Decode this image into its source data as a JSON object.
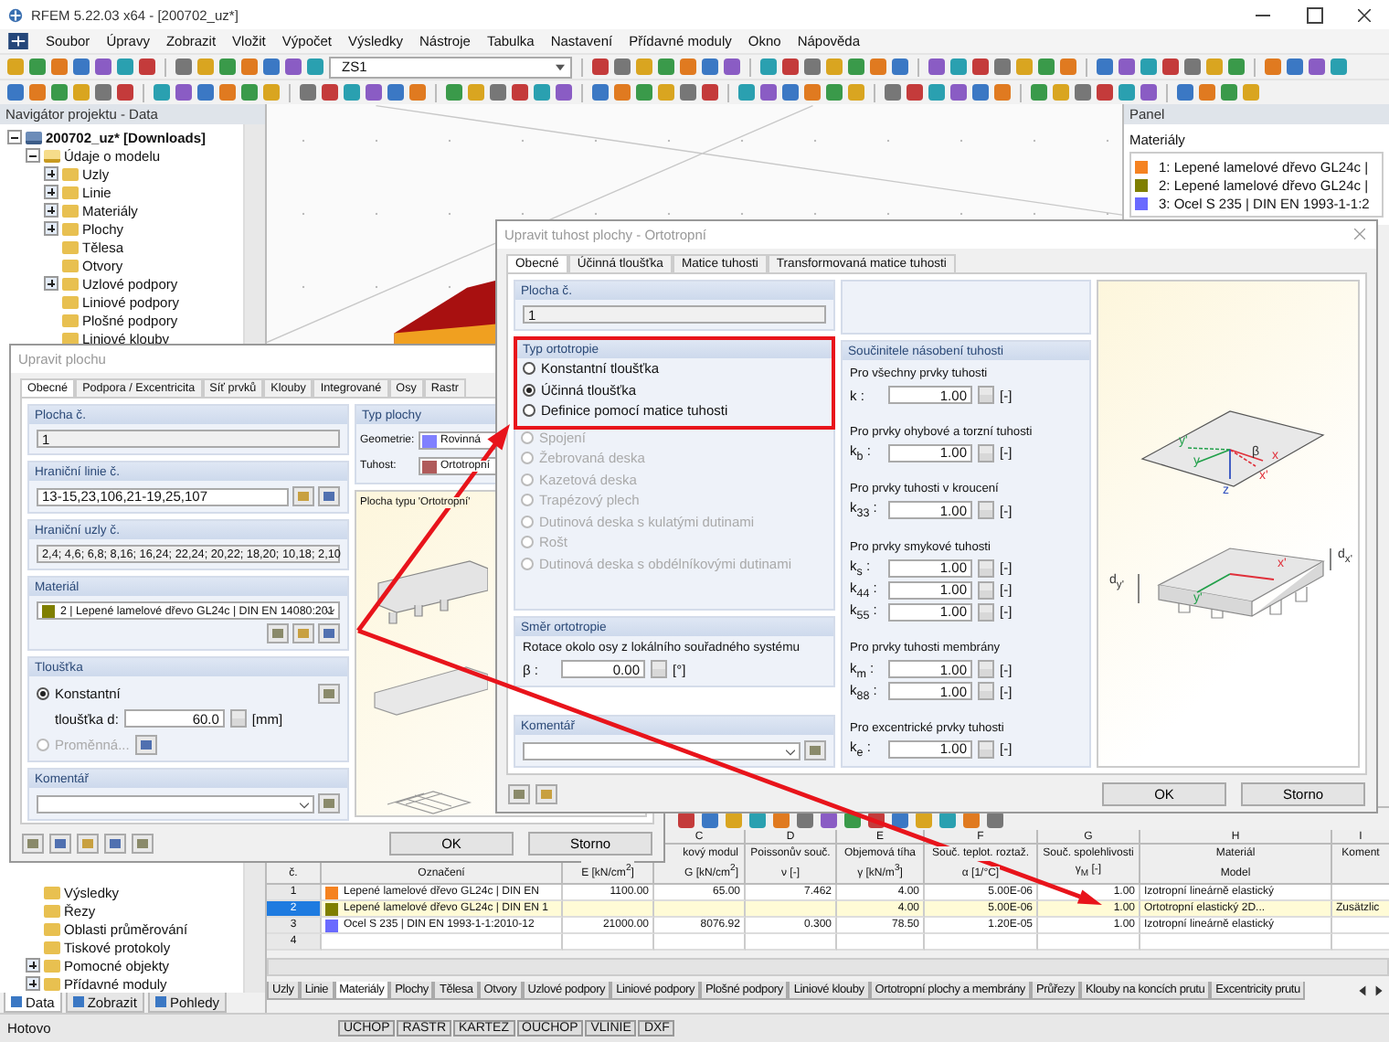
{
  "window": {
    "title": "RFEM 5.22.03 x64 - [200702_uz*]"
  },
  "menu": [
    "Soubor",
    "Úpravy",
    "Zobrazit",
    "Vložit",
    "Výpočet",
    "Výsledky",
    "Nástroje",
    "Tabulka",
    "Nastavení",
    "Přídavné moduly",
    "Okno",
    "Nápověda"
  ],
  "toolbar": {
    "load_case": "ZS1"
  },
  "navigator": {
    "title": "Navigátor projektu - Data",
    "tree": [
      {
        "label": "200702_uz* [Downloads]",
        "expandable": true,
        "expanded": true,
        "children": [
          {
            "label": "Údaje o modelu",
            "expandable": true,
            "expanded": true,
            "children": [
              {
                "label": "Uzly",
                "expandable": true,
                "expanded": false
              },
              {
                "label": "Linie",
                "expandable": true,
                "expanded": false
              },
              {
                "label": "Materiály",
                "expandable": true,
                "expanded": false
              },
              {
                "label": "Plochy",
                "expandable": true,
                "expanded": false
              },
              {
                "label": "Tělesa",
                "expandable": false
              },
              {
                "label": "Otvory",
                "expandable": false
              },
              {
                "label": "Uzlové podpory",
                "expandable": true,
                "expanded": false
              },
              {
                "label": "Liniové podpory",
                "expandable": false
              },
              {
                "label": "Plošné podpory",
                "expandable": false
              },
              {
                "label": "Liniové klouby",
                "expandable": false
              }
            ]
          }
        ]
      }
    ],
    "lower_items": [
      {
        "label": "Výsledky",
        "expandable": false
      },
      {
        "label": "Řezy",
        "expandable": false
      },
      {
        "label": "Oblasti průměrování",
        "expandable": false
      },
      {
        "label": "Tiskové protokoly",
        "expandable": false
      },
      {
        "label": "Pomocné objekty",
        "expandable": true,
        "expanded": false
      },
      {
        "label": "Přídavné moduly",
        "expandable": true,
        "expanded": false
      }
    ],
    "tabs": [
      {
        "label": "Data",
        "selected": true
      },
      {
        "label": "Zobrazit",
        "selected": false
      },
      {
        "label": "Pohledy",
        "selected": false
      }
    ]
  },
  "panel": {
    "title": "Panel",
    "section": "Materiály",
    "items": [
      {
        "label": "1: Lepené lamelové dřevo GL24c |",
        "color": "#f58220"
      },
      {
        "label": "2: Lepené lamelové dřevo GL24c |",
        "color": "#7f7f00"
      },
      {
        "label": "3: Ocel S 235 | DIN EN 1993-1-1:2",
        "color": "#6a6aff"
      }
    ]
  },
  "table": {
    "columns": [
      {
        "bottom": "č."
      },
      {
        "bottom": "Označení"
      },
      {
        "bottom": "E [kN/cm$^{2}$]"
      },
      {
        "letter": "C",
        "top": "kový modul",
        "bottom": "G [kN/cm$^{2}$]"
      },
      {
        "letter": "D",
        "top": "Poissonův souč.",
        "bottom": "ν [-]"
      },
      {
        "letter": "E",
        "top": "Objemová tíha",
        "bottom": "γ [kN/m$^{3}$]"
      },
      {
        "letter": "F",
        "top": "Souč. teplot. roztaž.",
        "bottom": "α [1/°C]"
      },
      {
        "letter": "G",
        "top": "Souč. spolehlivosti",
        "bottom": "γ$_{M}$ [-]"
      },
      {
        "letter": "H",
        "top": "Materiál",
        "bottom": "Model"
      },
      {
        "letter": "I",
        "top": "Koment"
      }
    ],
    "rows": [
      {
        "no": "1",
        "color": "#f58220",
        "selected": false,
        "cells": [
          "Lepené lamelové dřevo GL24c | DIN EN",
          "1100.00",
          "65.00",
          "7.462",
          "4.00",
          "5.00E-06",
          "1.00",
          "Izotropní lineárně elastický",
          null
        ]
      },
      {
        "no": "2",
        "color": "#7f7f00",
        "selected": true,
        "cells": [
          "Lepené lamelové dřevo GL24c | DIN EN 1",
          null,
          null,
          null,
          "4.00",
          "5.00E-06",
          "1.00",
          "Ortotropní elastický 2D...",
          "Zusätzlic"
        ]
      },
      {
        "no": "3",
        "color": "#6a6aff",
        "selected": false,
        "cells": [
          "Ocel S 235 | DIN EN 1993-1-1:2010-12",
          "21000.00",
          "8076.92",
          "0.300",
          "78.50",
          "1.20E-05",
          "1.00",
          "Izotropní lineárně elastický",
          null
        ]
      },
      {
        "no": "4",
        "selected": false
      }
    ]
  },
  "table_tabs": [
    {
      "label": "Uzly",
      "selected": false
    },
    {
      "label": "Linie",
      "selected": false
    },
    {
      "label": "Materiály",
      "selected": true
    },
    {
      "label": "Plochy",
      "selected": false
    },
    {
      "label": "Tělesa",
      "selected": false
    },
    {
      "label": "Otvory",
      "selected": false
    },
    {
      "label": "Uzlové podpory",
      "selected": false
    },
    {
      "label": "Liniové podpory",
      "selected": false
    },
    {
      "label": "Plošné podpory",
      "selected": false
    },
    {
      "label": "Liniové klouby",
      "selected": false
    },
    {
      "label": "Ortotropní plochy a membrány",
      "selected": false
    },
    {
      "label": "Průřezy",
      "selected": false
    },
    {
      "label": "Klouby na koncích prutu",
      "selected": false
    },
    {
      "label": "Excentricity prutu",
      "selected": false
    }
  ],
  "status_bar": {
    "text": "Hotovo",
    "toggles": [
      "UCHOP",
      "RASTR",
      "KARTEZ",
      "OUCHOP",
      "VLINIE",
      "DXF"
    ]
  },
  "surface_dialog": {
    "title": "Upravit plochu",
    "tabs": [
      {
        "label": "Obecné",
        "selected": true
      },
      {
        "label": "Podpora / Excentricita",
        "selected": false
      },
      {
        "label": "Síť prvků",
        "selected": false
      },
      {
        "label": "Klouby",
        "selected": false
      },
      {
        "label": "Integrované",
        "selected": false
      },
      {
        "label": "Osy",
        "selected": false
      },
      {
        "label": "Rastr",
        "selected": false
      }
    ],
    "surface_no": {
      "label": "Plocha č.",
      "value": "1"
    },
    "boundary_lines": {
      "label": "Hraniční linie č.",
      "value": "13-15,23,106,21-19,25,107"
    },
    "boundary_nodes": {
      "label": "Hraniční uzly č.",
      "value": "2,4; 4,6; 6,8; 8,16; 16,24; 22,24; 20,22; 18,20; 10,18; 2,10"
    },
    "material": {
      "label": "Materiál",
      "color": "#7f7f00",
      "value": "2 | Lepené lamelové dřevo GL24c | DIN EN 14080:201"
    },
    "thickness": {
      "label": "Tloušťka",
      "options": [
        {
          "label": "Konstantní",
          "selected": true,
          "disabled": false
        },
        {
          "label": "Proměnná...",
          "selected": false,
          "disabled": true
        }
      ],
      "field_label": "tloušťka d:",
      "value": "60.0",
      "unit": "[mm]"
    },
    "comment": {
      "label": "Komentář"
    },
    "surface_type": {
      "label": "Typ plochy",
      "rows": [
        {
          "label": "Geometrie:",
          "value": "Rovinná",
          "color": "#8080ff"
        },
        {
          "label": "Tuhost:",
          "value": "Ortotropní",
          "color": "#b05a5a"
        }
      ]
    },
    "preview_caption": "Plocha typu 'Ortotropní'",
    "buttons": [
      "OK",
      "Storno"
    ]
  },
  "stiffness_dialog": {
    "title": "Upravit tuhost plochy - Ortotropní",
    "tabs": [
      {
        "label": "Obecné",
        "selected": true
      },
      {
        "label": "Účinná tloušťka",
        "selected": false
      },
      {
        "label": "Matice tuhosti",
        "selected": false
      },
      {
        "label": "Transformovaná matice tuhosti",
        "selected": false
      }
    ],
    "surface_no": {
      "label": "Plocha č.",
      "value": "1"
    },
    "orthotropy_type": {
      "label": "Typ ortotropie",
      "highlighted": true,
      "options": [
        {
          "label": "Konstantní tloušťka",
          "selected": false,
          "disabled": false
        },
        {
          "label": "Účinná tloušťka",
          "selected": true,
          "disabled": false
        },
        {
          "label": "Definice pomocí matice tuhosti",
          "selected": false,
          "disabled": false
        }
      ],
      "more_options": [
        {
          "label": "Spojení",
          "selected": false,
          "disabled": true
        },
        {
          "label": "Žebrovaná deska",
          "selected": false,
          "disabled": true
        },
        {
          "label": "Kazetová deska",
          "selected": false,
          "disabled": true
        },
        {
          "label": "Trapézový plech",
          "selected": false,
          "disabled": true
        },
        {
          "label": "Dutinová deska s kulatými dutinami",
          "selected": false,
          "disabled": true
        },
        {
          "label": "Rošt",
          "selected": false,
          "disabled": true
        },
        {
          "label": "Dutinová deska s obdélníkovými dutinami",
          "selected": false,
          "disabled": true
        }
      ]
    },
    "direction": {
      "label": "Směr ortotropie",
      "text": "Rotace okolo osy z lokálního souřadného systému",
      "field_label": "β :",
      "value": "0.00",
      "unit": "[°]"
    },
    "comment": {
      "label": "Komentář"
    },
    "factors": {
      "label": "Součinitele násobení tuhosti",
      "groups": [
        {
          "title": "Pro všechny prvky tuhosti",
          "fields": [
            {
              "label": "k :",
              "value": "1.00",
              "unit": "[-]"
            }
          ]
        },
        {
          "title": "Pro prvky ohybové a torzní tuhosti",
          "fields": [
            {
              "label": "k$_{b}$ :",
              "value": "1.00",
              "unit": "[-]"
            }
          ]
        },
        {
          "title": "Pro prvky tuhosti v kroucení",
          "fields": [
            {
              "label": "k$_{33}$ :",
              "value": "1.00",
              "unit": "[-]"
            }
          ]
        },
        {
          "title": "Pro prvky smykové tuhosti",
          "fields": [
            {
              "label": "k$_{s}$ :",
              "value": "1.00",
              "unit": "[-]"
            },
            {
              "label": "k$_{44}$ :",
              "value": "1.00",
              "unit": "[-]"
            },
            {
              "label": "k$_{55}$ :",
              "value": "1.00",
              "unit": "[-]"
            }
          ]
        },
        {
          "title": "Pro prvky tuhosti membrány",
          "fields": [
            {
              "label": "k$_{m}$ :",
              "value": "1.00",
              "unit": "[-]"
            },
            {
              "label": "k$_{88}$ :",
              "value": "1.00",
              "unit": "[-]"
            }
          ]
        },
        {
          "title": "Pro excentrické prvky tuhosti",
          "fields": [
            {
              "label": "k$_{e}$ :",
              "value": "1.00",
              "unit": "[-]"
            }
          ]
        }
      ]
    },
    "diagram_labels": [
      {
        "text": "y'",
        "color": "#22a04a"
      },
      {
        "text": "y",
        "color": "#22a04a"
      },
      {
        "text": "β",
        "color": "#333333"
      },
      {
        "text": "x",
        "color": "#e0303a"
      },
      {
        "text": "x'",
        "color": "#e0303a"
      },
      {
        "text": "z",
        "color": "#3050c0"
      },
      {
        "text": "d$_{y'}$",
        "color": "#333333"
      },
      {
        "text": "d$_{x'}$",
        "color": "#333333"
      },
      {
        "text": "y'",
        "color": "#22a04a"
      },
      {
        "text": "x'",
        "color": "#e0303a"
      }
    ],
    "buttons": [
      "OK",
      "Storno"
    ]
  }
}
